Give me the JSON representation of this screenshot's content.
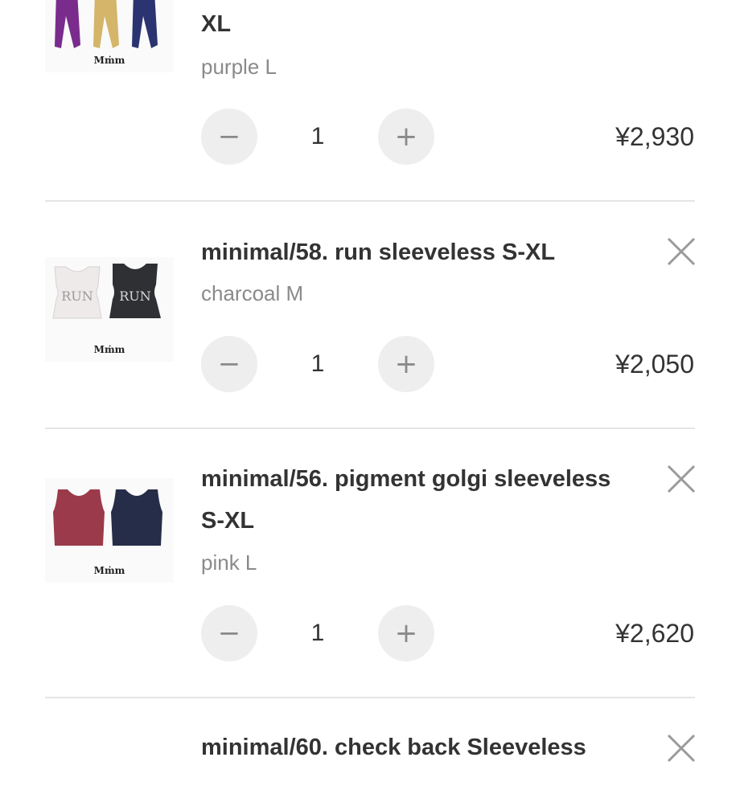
{
  "cart": {
    "items": [
      {
        "title": "XL",
        "variant": "purple L",
        "quantity": "1",
        "price": "¥2,930",
        "minus_icon": "minus-icon",
        "plus_icon": "plus-icon",
        "thumb_brand": "Mṁm"
      },
      {
        "title": "minimal/58. run sleeveless S-XL",
        "variant": "charcoal M",
        "quantity": "1",
        "price": "¥2,050",
        "remove_icon": "close-icon",
        "minus_icon": "minus-icon",
        "plus_icon": "plus-icon",
        "thumb_brand": "Mṁm",
        "thumb_print": "RUN"
      },
      {
        "title": "minimal/56. pigment golgi sleeveless S-XL",
        "variant": "pink L",
        "quantity": "1",
        "price": "¥2,620",
        "remove_icon": "close-icon",
        "minus_icon": "minus-icon",
        "plus_icon": "plus-icon",
        "thumb_brand": "Mṁm"
      },
      {
        "title": "minimal/60. check back Sleeveless",
        "remove_icon": "close-icon"
      }
    ],
    "button_symbols": {
      "minus": "−",
      "plus": "+"
    }
  },
  "colors": {
    "divider": "#e5e5e5",
    "button_bg": "#eeeeee",
    "text": "#333333",
    "muted_text": "#8a8a8a"
  }
}
